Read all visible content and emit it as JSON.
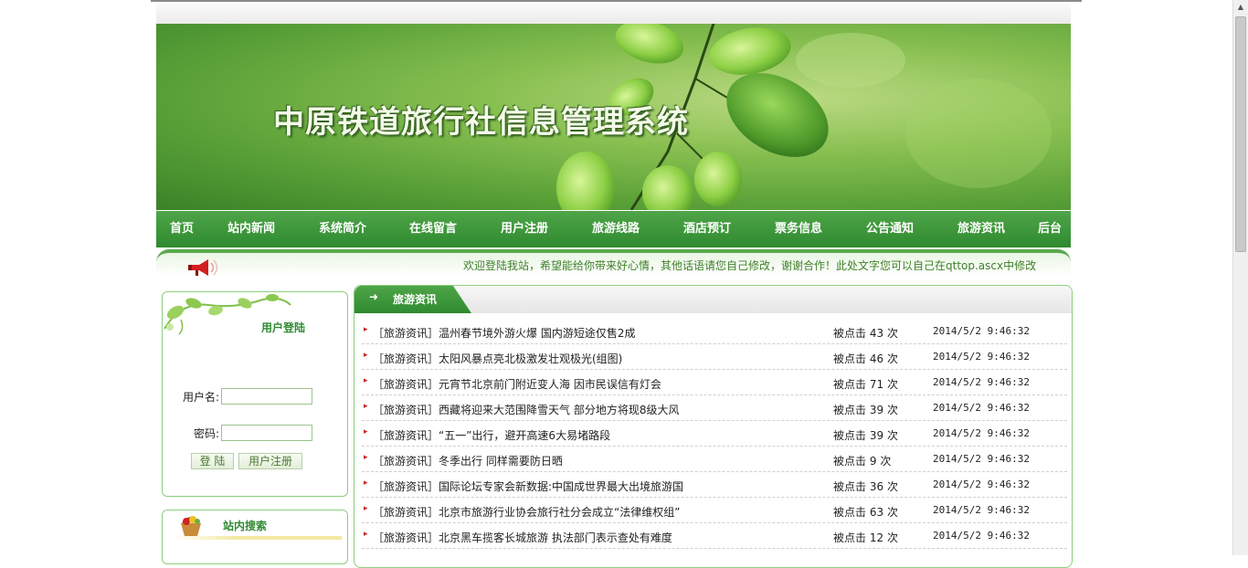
{
  "banner": {
    "title": "中原铁道旅行社信息管理系统"
  },
  "nav": {
    "items": [
      {
        "label": "首页"
      },
      {
        "label": "站内新闻"
      },
      {
        "label": "系统简介"
      },
      {
        "label": "在线留言"
      },
      {
        "label": "用户注册"
      },
      {
        "label": "旅游线路"
      },
      {
        "label": "酒店预订"
      },
      {
        "label": "票务信息"
      },
      {
        "label": "公告通知"
      },
      {
        "label": "旅游资讯"
      },
      {
        "label": "后台"
      }
    ]
  },
  "marquee": {
    "text": "欢迎登陆我站，希望能给你带来好心情，其他话语请您自己修改，谢谢合作！此处文字您可以自己在qttop.ascx中修改"
  },
  "login": {
    "title": "用户登陆",
    "username_label": "用户名:",
    "username_value": "",
    "password_label": "密码:",
    "password_value": "",
    "login_button": "登 陆",
    "register_button": "用户注册"
  },
  "search": {
    "title": "站内搜索"
  },
  "news": {
    "tab_arrow": "➜",
    "tab_title": "旅游资讯",
    "bullet": "▸",
    "hits_prefix": "被点击",
    "hits_suffix": "次",
    "rows": [
      {
        "title": "［旅游资讯］温州春节境外游火爆 国内游短途仅售2成",
        "hits": "43",
        "date": "2014/5/2 9:46:32"
      },
      {
        "title": "［旅游资讯］太阳风暴点亮北极激发壮观极光(组图)",
        "hits": "46",
        "date": "2014/5/2 9:46:32"
      },
      {
        "title": "［旅游资讯］元宵节北京前门附近变人海 因市民误信有灯会",
        "hits": "71",
        "date": "2014/5/2 9:46:32"
      },
      {
        "title": "［旅游资讯］西藏将迎来大范围降雪天气 部分地方将现8级大风",
        "hits": "39",
        "date": "2014/5/2 9:46:32"
      },
      {
        "title": "［旅游资讯］“五一”出行，避开高速6大易堵路段",
        "hits": "39",
        "date": "2014/5/2 9:46:32"
      },
      {
        "title": "［旅游资讯］冬季出行 同样需要防日晒",
        "hits": "9",
        "date": "2014/5/2 9:46:32"
      },
      {
        "title": "［旅游资讯］国际论坛专家会新数据:中国成世界最大出境旅游国",
        "hits": "36",
        "date": "2014/5/2 9:46:32"
      },
      {
        "title": "［旅游资讯］北京市旅游行业协会旅行社分会成立“法律维权组”",
        "hits": "63",
        "date": "2014/5/2 9:46:32"
      },
      {
        "title": "［旅游资讯］北京黑车揽客长城旅游 执法部门表示查处有难度",
        "hits": "12",
        "date": "2014/5/2 9:46:32"
      }
    ]
  },
  "colors": {
    "nav_green": "#2f8a30",
    "accent_green": "#5aa94f",
    "bullet_red": "#c62828"
  }
}
